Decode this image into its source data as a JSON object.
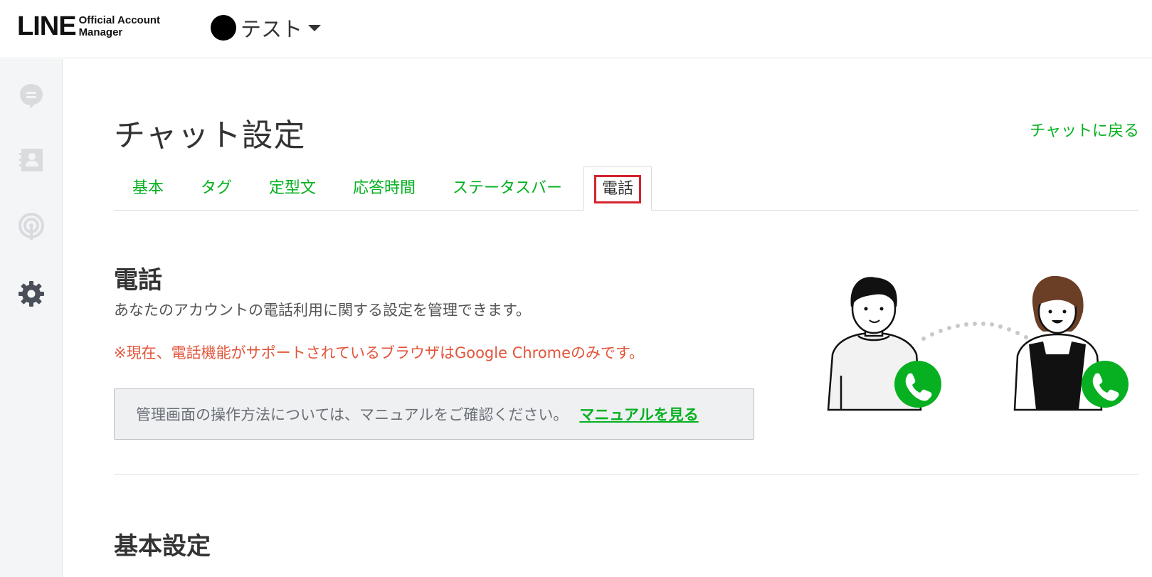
{
  "header": {
    "logo_main": "LINE",
    "logo_sub_line1": "Official Account",
    "logo_sub_line2": "Manager",
    "account_name": "テスト"
  },
  "sidebar": {
    "items": [
      {
        "icon": "chat-icon"
      },
      {
        "icon": "contacts-icon"
      },
      {
        "icon": "broadcast-icon"
      },
      {
        "icon": "gear-icon"
      }
    ]
  },
  "page": {
    "title": "チャット設定",
    "back_link": "チャットに戻る"
  },
  "tabs": [
    {
      "label": "基本"
    },
    {
      "label": "タグ"
    },
    {
      "label": "定型文"
    },
    {
      "label": "応答時間"
    },
    {
      "label": "ステータスバー"
    },
    {
      "label": "電話",
      "active": true
    }
  ],
  "phone_section": {
    "title": "電話",
    "description": "あなたのアカウントの電話利用に関する設定を管理できます。",
    "warning": "※現在、電話機能がサポートされているブラウザはGoogle Chromeのみです。",
    "manual_text": "管理画面の操作方法については、マニュアルをご確認ください。",
    "manual_link": "マニュアルを見る"
  },
  "basic_section": {
    "title": "基本設定"
  },
  "colors": {
    "brand_green": "#06b020",
    "warning_red": "#e2543a",
    "highlight_red": "#d3232f"
  }
}
